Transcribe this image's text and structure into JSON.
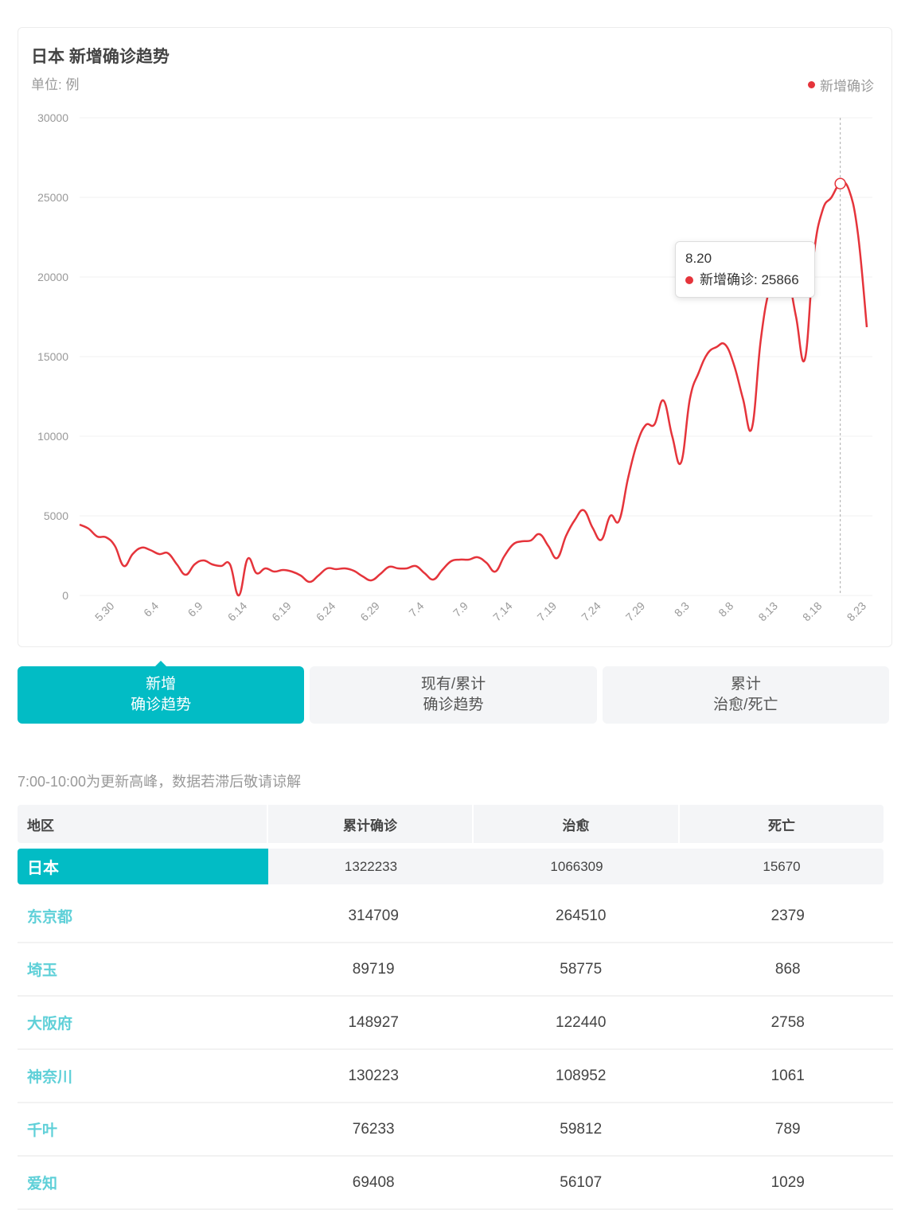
{
  "header": {
    "title": "日本 新增确诊趋势",
    "unit": "单位: 例"
  },
  "colors": {
    "series": "#e5343b",
    "accent": "#02bcc5",
    "region_link": "#5fd0d8"
  },
  "chart_data": {
    "type": "line",
    "title": "日本 新增确诊趋势",
    "subtitle": "单位: 例",
    "xlabel": "",
    "ylabel": "",
    "ylim": [
      0,
      30000
    ],
    "yticks": [
      0,
      5000,
      10000,
      15000,
      20000,
      25000,
      30000
    ],
    "xtick_labels": [
      "5.30",
      "6.4",
      "6.9",
      "6.14",
      "6.19",
      "6.24",
      "6.29",
      "7.4",
      "7.9",
      "7.14",
      "7.19",
      "7.24",
      "7.29",
      "8.3",
      "8.8",
      "8.13",
      "8.18",
      "8.23"
    ],
    "grid": true,
    "legend_position": "top-right",
    "smooth": true,
    "x": [
      "5.26",
      "5.27",
      "5.28",
      "5.29",
      "5.30",
      "5.31",
      "6.1",
      "6.2",
      "6.3",
      "6.4",
      "6.5",
      "6.6",
      "6.7",
      "6.8",
      "6.9",
      "6.10",
      "6.11",
      "6.12",
      "6.13",
      "6.14",
      "6.15",
      "6.16",
      "6.17",
      "6.18",
      "6.19",
      "6.20",
      "6.21",
      "6.22",
      "6.23",
      "6.24",
      "6.25",
      "6.26",
      "6.27",
      "6.28",
      "6.29",
      "6.30",
      "7.1",
      "7.2",
      "7.3",
      "7.4",
      "7.5",
      "7.6",
      "7.7",
      "7.8",
      "7.9",
      "7.10",
      "7.11",
      "7.12",
      "7.13",
      "7.14",
      "7.15",
      "7.16",
      "7.17",
      "7.18",
      "7.19",
      "7.20",
      "7.21",
      "7.22",
      "7.23",
      "7.24",
      "7.25",
      "7.26",
      "7.27",
      "7.28",
      "7.29",
      "7.30",
      "7.31",
      "8.1",
      "8.2",
      "8.3",
      "8.4",
      "8.5",
      "8.6",
      "8.7",
      "8.8",
      "8.9",
      "8.10",
      "8.11",
      "8.12",
      "8.13",
      "8.14",
      "8.15",
      "8.16",
      "8.17",
      "8.18",
      "8.19",
      "8.20",
      "8.21",
      "8.22",
      "8.23"
    ],
    "series": [
      {
        "name": "新增确诊",
        "color": "#e5343b",
        "values": [
          4450,
          4200,
          3700,
          3650,
          3100,
          1850,
          2600,
          3000,
          2850,
          2600,
          2650,
          1950,
          1300,
          1950,
          2200,
          1950,
          1850,
          1950,
          0,
          2300,
          1400,
          1700,
          1500,
          1600,
          1500,
          1250,
          850,
          1250,
          1700,
          1650,
          1700,
          1550,
          1200,
          950,
          1350,
          1800,
          1700,
          1700,
          1850,
          1400,
          1000,
          1600,
          2150,
          2250,
          2250,
          2400,
          2050,
          1500,
          2450,
          3200,
          3400,
          3450,
          3850,
          3100,
          2350,
          3750,
          4750,
          5350,
          4250,
          3500,
          5000,
          4700,
          7350,
          9500,
          10700,
          10750,
          12250,
          10000,
          8350,
          12350,
          14000,
          15200,
          15600,
          15750,
          14450,
          12350,
          10500,
          16000,
          19300,
          20500,
          20200,
          17500,
          14850,
          21350,
          24200,
          25000,
          25866,
          25450,
          22700,
          16850
        ]
      }
    ],
    "tooltip": {
      "date": "8.20",
      "series_name": "新增确诊",
      "value": 25866,
      "text": "新增确诊: 25866"
    }
  },
  "tabs": [
    {
      "line1": "新增",
      "line2": "确诊趋势",
      "active": true
    },
    {
      "line1": "现有/累计",
      "line2": "确诊趋势",
      "active": false
    },
    {
      "line1": "累计",
      "line2": "治愈/死亡",
      "active": false
    }
  ],
  "notice": "7:00-10:00为更新高峰，数据若滞后敬请谅解",
  "table": {
    "headers": [
      "地区",
      "累计确诊",
      "治愈",
      "死亡"
    ],
    "total": {
      "region": "日本",
      "confirmed": "1322233",
      "cured": "1066309",
      "dead": "15670"
    },
    "rows": [
      {
        "region": "东京都",
        "confirmed": "314709",
        "cured": "264510",
        "dead": "2379"
      },
      {
        "region": "埼玉",
        "confirmed": "89719",
        "cured": "58775",
        "dead": "868"
      },
      {
        "region": "大阪府",
        "confirmed": "148927",
        "cured": "122440",
        "dead": "2758"
      },
      {
        "region": "神奈川",
        "confirmed": "130223",
        "cured": "108952",
        "dead": "1061"
      },
      {
        "region": "千叶",
        "confirmed": "76233",
        "cured": "59812",
        "dead": "789"
      },
      {
        "region": "爱知",
        "confirmed": "69408",
        "cured": "56107",
        "dead": "1029"
      }
    ]
  }
}
